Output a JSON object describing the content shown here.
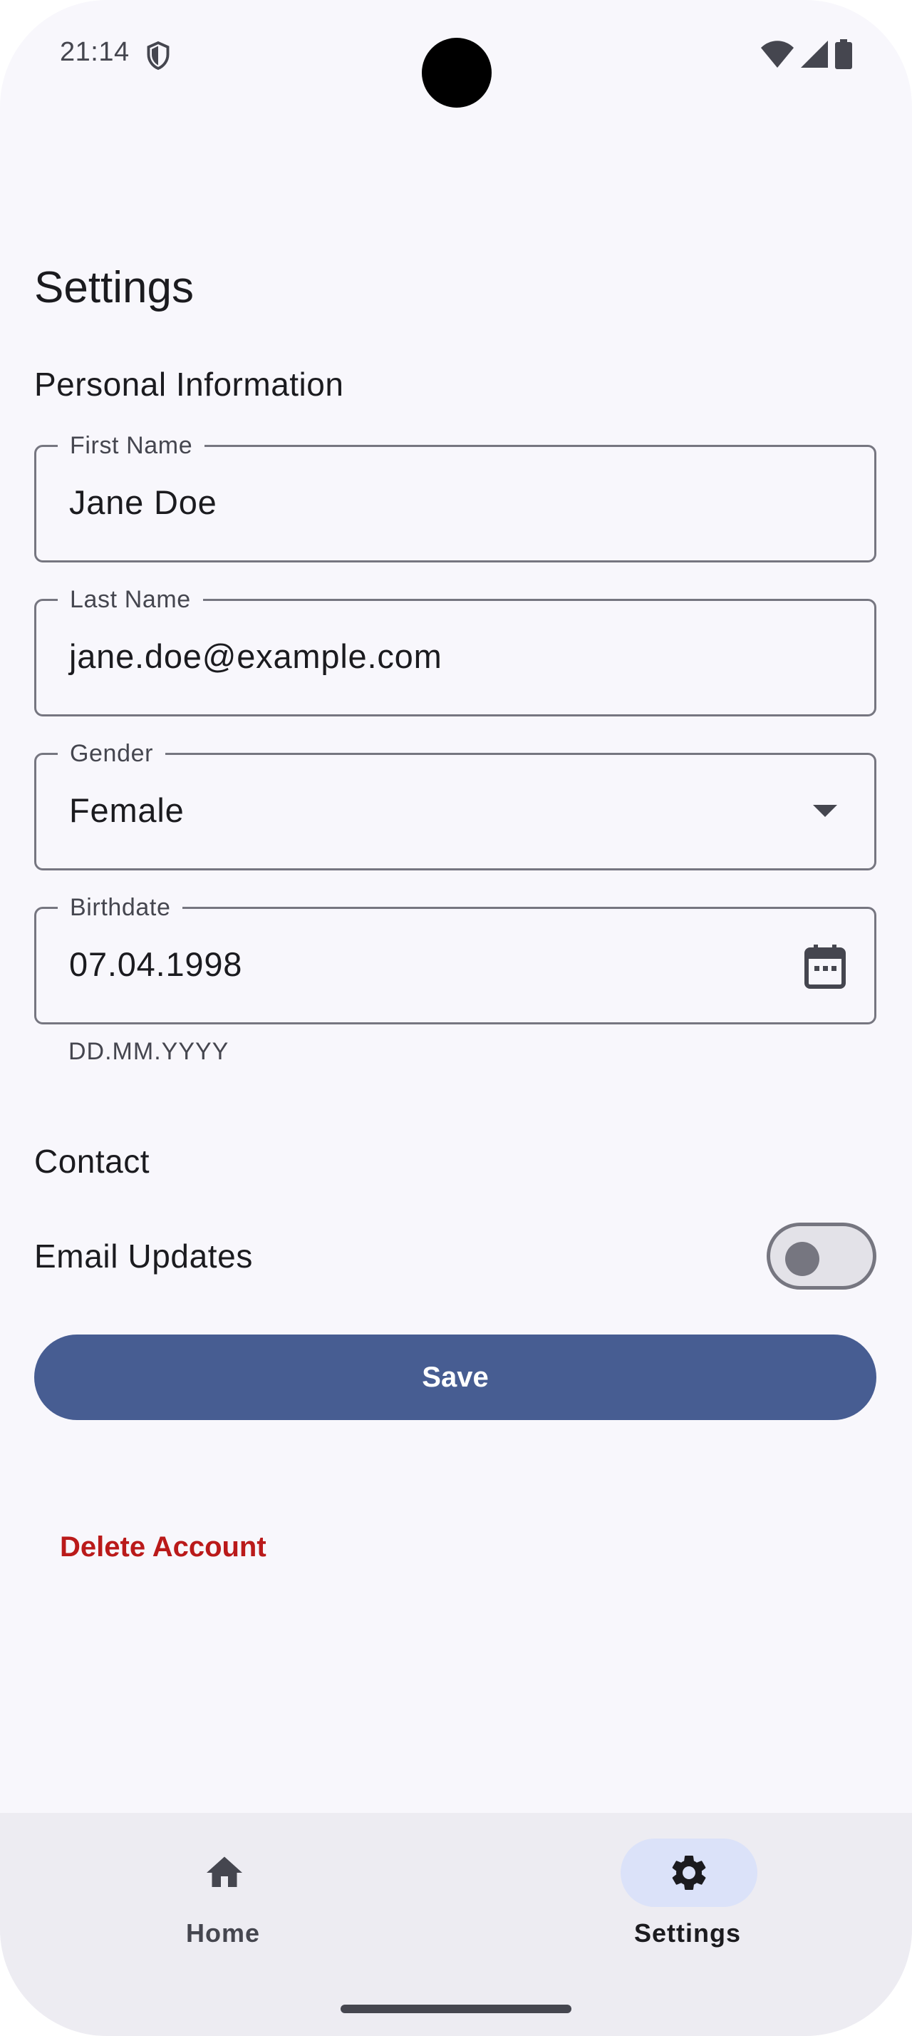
{
  "status_bar": {
    "time": "21:14"
  },
  "page": {
    "title": "Settings"
  },
  "personal_section": {
    "title": "Personal Information"
  },
  "fields": {
    "first_name": {
      "label": "First Name",
      "value": "Jane Doe"
    },
    "last_name": {
      "label": "Last Name",
      "value": "jane.doe@example.com"
    },
    "gender": {
      "label": "Gender",
      "value": "Female"
    },
    "birthdate": {
      "label": "Birthdate",
      "value": "07.04.1998",
      "helper": "DD.MM.YYYY"
    }
  },
  "contact_section": {
    "title": "Contact"
  },
  "email_updates": {
    "label": "Email Updates",
    "enabled": false
  },
  "actions": {
    "save_label": "Save",
    "delete_label": "Delete Account"
  },
  "nav": {
    "items": [
      {
        "label": "Home",
        "icon": "home-icon",
        "selected": false
      },
      {
        "label": "Settings",
        "icon": "gear-icon",
        "selected": true
      }
    ]
  },
  "colors": {
    "primary": "#475d92",
    "error": "#ba1a1a",
    "background": "#f8f7fc",
    "nav_background": "#edecf2",
    "selected_indicator": "#dbe2f9"
  }
}
